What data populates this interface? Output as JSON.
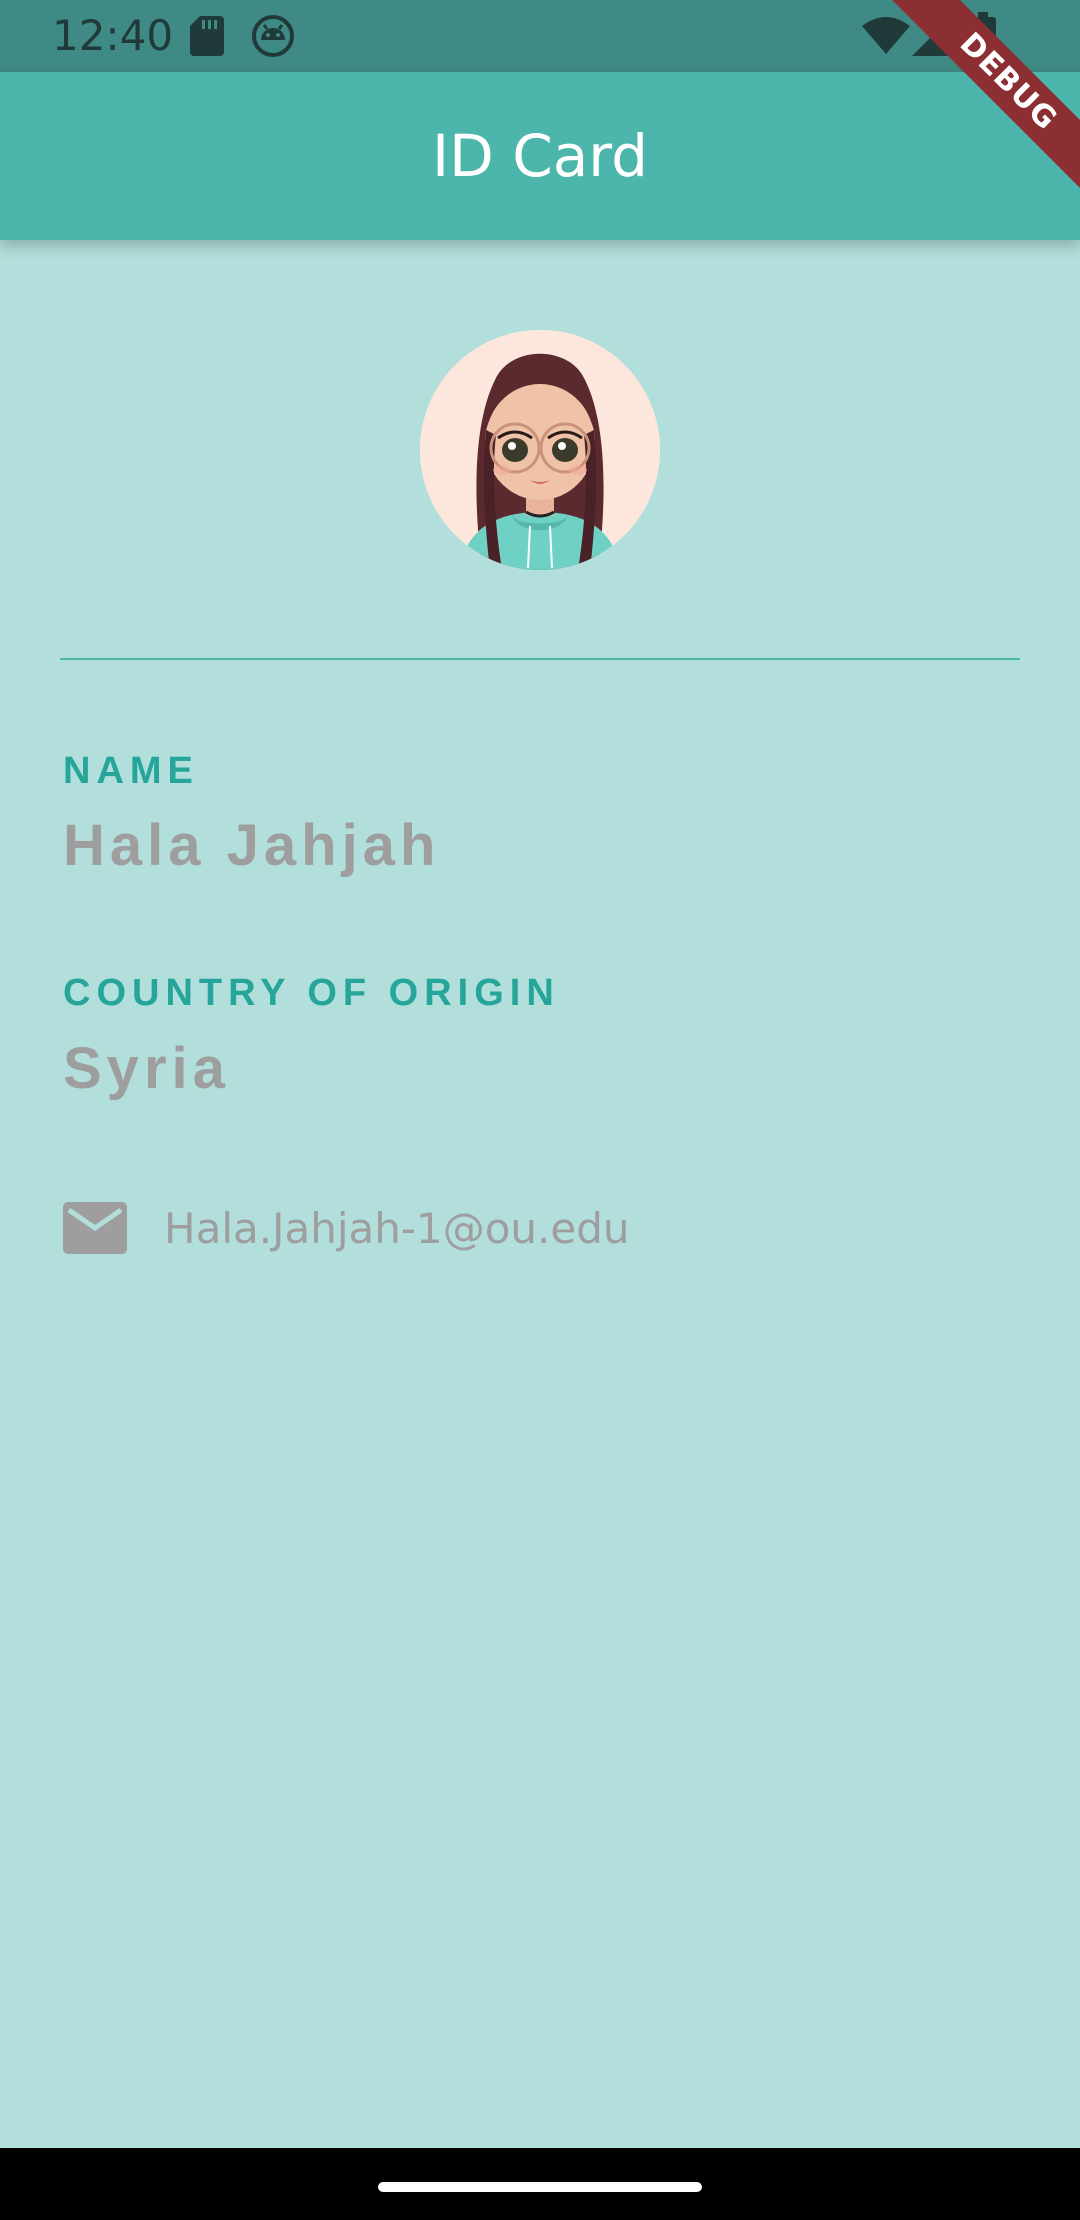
{
  "status_bar": {
    "time": "12:40",
    "icons": [
      "sd-card-icon",
      "android-debug-icon",
      "wifi-icon",
      "cell-signal-icon",
      "battery-icon"
    ]
  },
  "app_bar": {
    "title": "ID Card"
  },
  "debug_banner": {
    "label": "DEBUG"
  },
  "profile": {
    "avatar_icon": "avatar",
    "name_label": "NAME",
    "name_value": "Hala Jahjah",
    "country_label": "COUNTRY OF ORIGIN",
    "country_value": "Syria",
    "email_icon": "email-icon",
    "email": "Hala.Jahjah-1@ou.edu"
  },
  "colors": {
    "background": "#b2dfdb",
    "app_bar": "#4db6ac",
    "status_bar": "#3f8a84",
    "label": "#26a69a",
    "value": "#9e9e9e"
  }
}
